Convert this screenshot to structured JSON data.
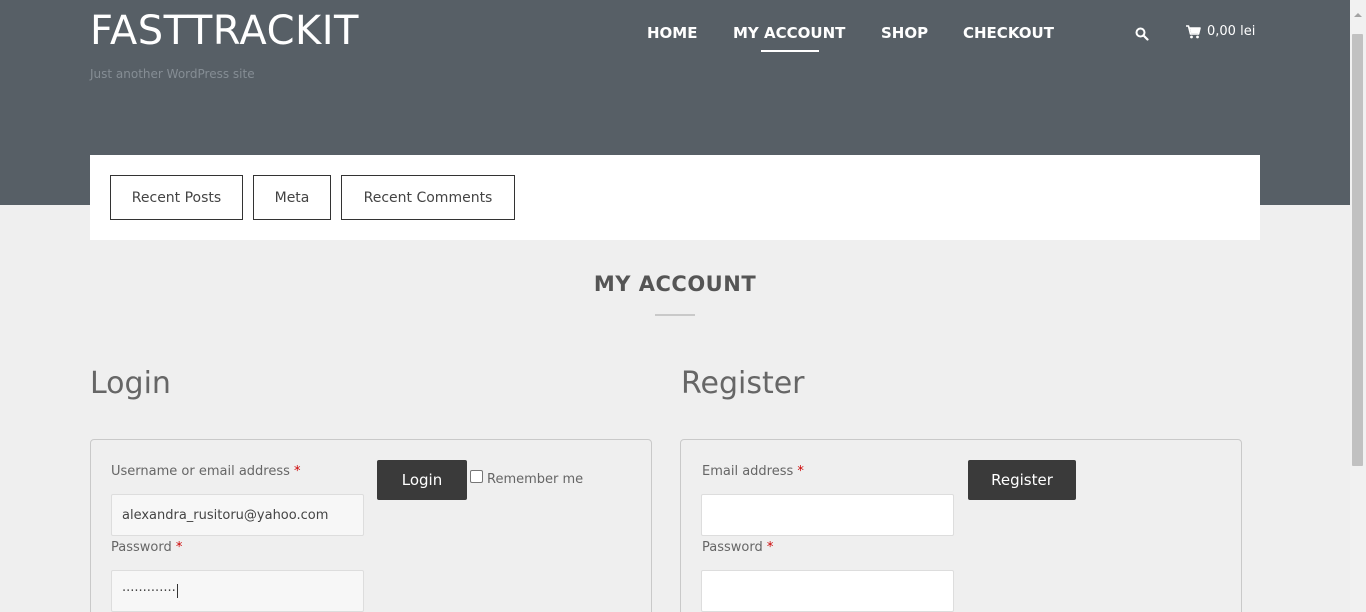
{
  "site": {
    "title": "FASTTRACKIT",
    "tagline": "Just another WordPress site"
  },
  "nav": {
    "items": [
      {
        "label": "HOME"
      },
      {
        "label": "MY ACCOUNT",
        "active": true
      },
      {
        "label": "SHOP"
      },
      {
        "label": "CHECKOUT"
      }
    ],
    "search_icon": "search-icon",
    "cart": {
      "icon": "cart-icon",
      "total": "0,00 lei"
    }
  },
  "widgets": {
    "tabs": [
      {
        "label": "Recent Posts"
      },
      {
        "label": "Meta"
      },
      {
        "label": "Recent Comments"
      }
    ]
  },
  "page": {
    "title": "MY ACCOUNT"
  },
  "login": {
    "heading": "Login",
    "username_label": "Username or email address",
    "username_value": "alexandra_rusitoru@yahoo.com",
    "password_label": "Password",
    "password_value": "·············",
    "required_mark": "*",
    "button_label": "Login",
    "remember_label": "Remember me",
    "remember_checked": false
  },
  "register": {
    "heading": "Register",
    "email_label": "Email address",
    "email_value": "",
    "password_label": "Password",
    "password_value": "",
    "required_mark": "*",
    "button_label": "Register"
  },
  "colors": {
    "header_bg": "#575f66",
    "page_bg": "#efefef",
    "button_dark": "#3a3a3a",
    "required": "#cc0000"
  }
}
